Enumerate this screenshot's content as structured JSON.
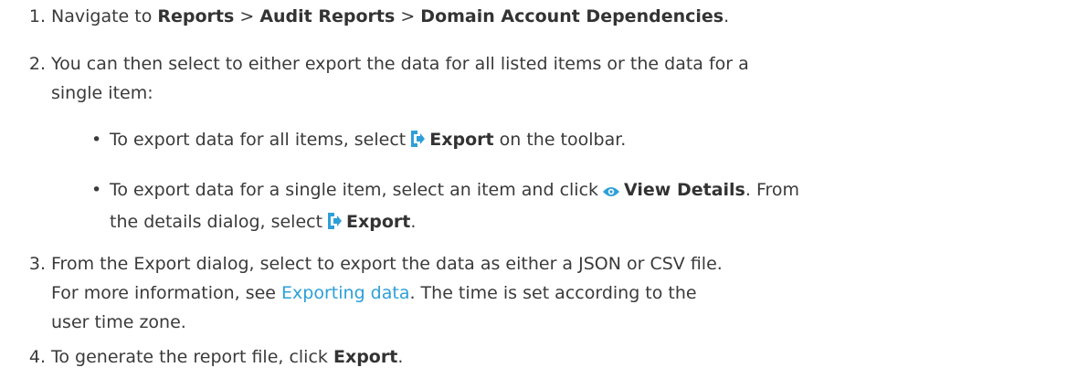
{
  "steps": [
    {
      "num": "1.",
      "prefix": "Navigate to ",
      "crumb1": "Reports",
      "sep1": " > ",
      "crumb2": "Audit Reports",
      "sep2": " > ",
      "crumb3": "Domain Account Dependencies",
      "suffix": "."
    },
    {
      "num": "2.",
      "line1": "You can then select to either export the data for all listed items or the data for a",
      "line2": "single item:",
      "bullets": [
        {
          "pre": "To export data for all items, select",
          "icon": "export-icon",
          "bold": "Export",
          "post": " on the toolbar."
        },
        {
          "pre": "To export data for a single item, select an item and click",
          "icon": "eye-icon",
          "bold": "View Details",
          "post": ". From",
          "line2_pre": "the details dialog, select",
          "icon2": "export-icon",
          "bold2": "Export",
          "post2": "."
        }
      ]
    },
    {
      "num": "3.",
      "line1": "From the Export dialog, select to export the data as either a JSON or CSV file.",
      "line2_pre": "For more information, see ",
      "link": "Exporting data",
      "line2_post": ". The time is set according to the",
      "line3": "user time zone."
    },
    {
      "num": "4.",
      "pre": "To generate the report file, click ",
      "bold": "Export",
      "post": "."
    }
  ],
  "colors": {
    "text": "#3a3a3a",
    "link": "#2e9fd8",
    "icon": "#2e9fd8"
  }
}
